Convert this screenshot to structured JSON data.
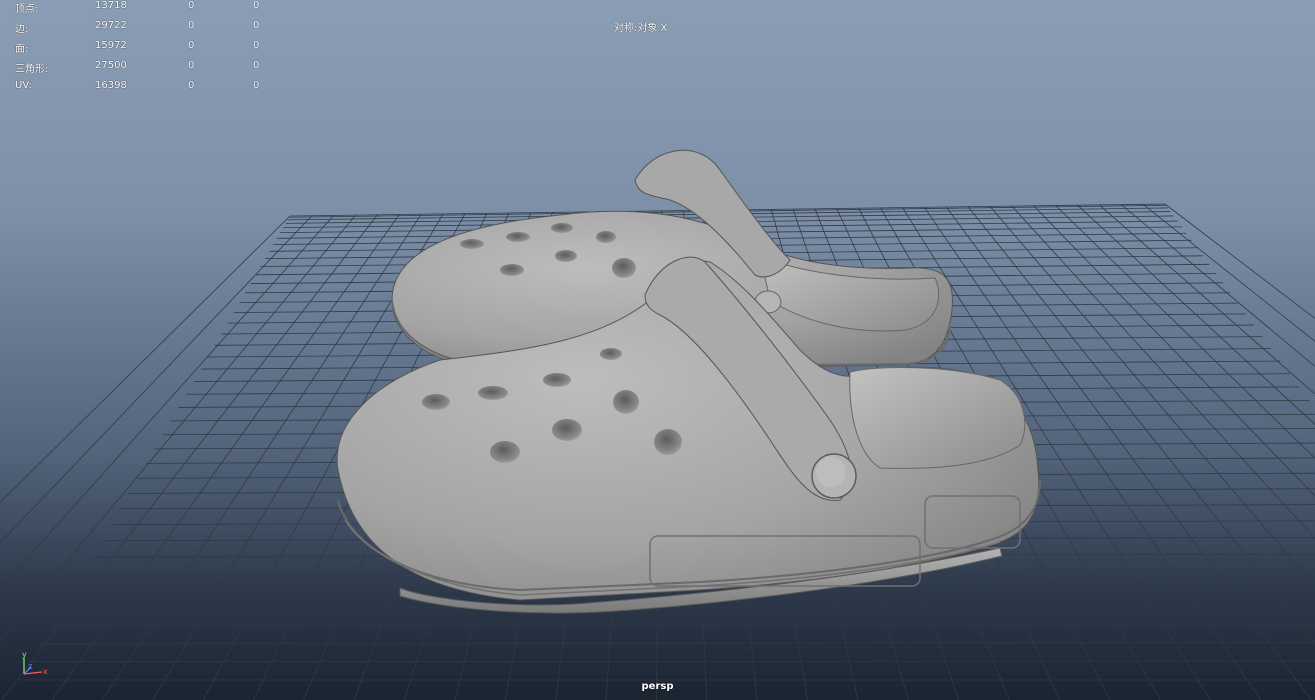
{
  "hud": {
    "rows": [
      {
        "label": "顶点:",
        "c1": "13718",
        "c2": "0",
        "c3": "0"
      },
      {
        "label": "边:",
        "c1": "29722",
        "c2": "0",
        "c3": "0"
      },
      {
        "label": "面:",
        "c1": "15972",
        "c2": "0",
        "c3": "0"
      },
      {
        "label": "三角形:",
        "c1": "27500",
        "c2": "0",
        "c3": "0"
      },
      {
        "label": "UV:",
        "c1": "16398",
        "c2": "0",
        "c3": "0"
      }
    ]
  },
  "symmetry_label": "对称:对象 X",
  "camera_label": "persp",
  "axis": {
    "y": "y",
    "x": "x",
    "z": "z"
  },
  "colors": {
    "grid": "#2f3a48",
    "model": "#9a9a9a",
    "axis_y": "#7cf07c",
    "axis_x": "#ff5a5a",
    "axis_z": "#5a8cff"
  }
}
